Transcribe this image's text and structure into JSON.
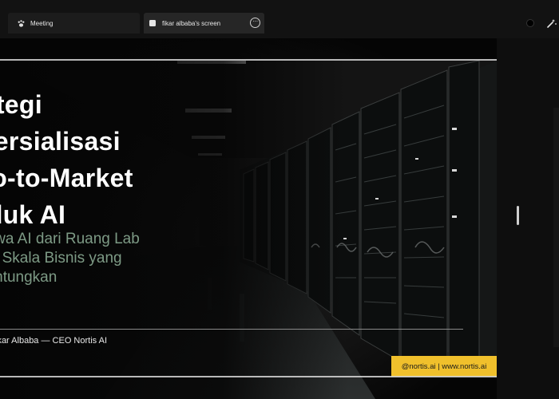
{
  "tabs": {
    "meeting": {
      "label": "Meeting",
      "icon": "paw-icon"
    },
    "screen": {
      "label": "fikar albaba's screen",
      "icon": "window-icon",
      "menu_icon": "more-icon"
    }
  },
  "controls": {
    "record_icon": "record-dot-icon",
    "tool_icon": "pen-sparkle-icon"
  },
  "slide": {
    "title": "rategi\nmersialisasi\nGo-to-Market\noduk AI",
    "subtitle": "bawa AI dari Ruang Lab\nuju Skala Bisnis yang\nguntungkan",
    "presenter": "ikar Albaba — CEO Nortis AI",
    "contact": "@nortis.ai | www.nortis.ai",
    "accent_color": "#f0c02c",
    "subtitle_color": "#7d9a85"
  }
}
